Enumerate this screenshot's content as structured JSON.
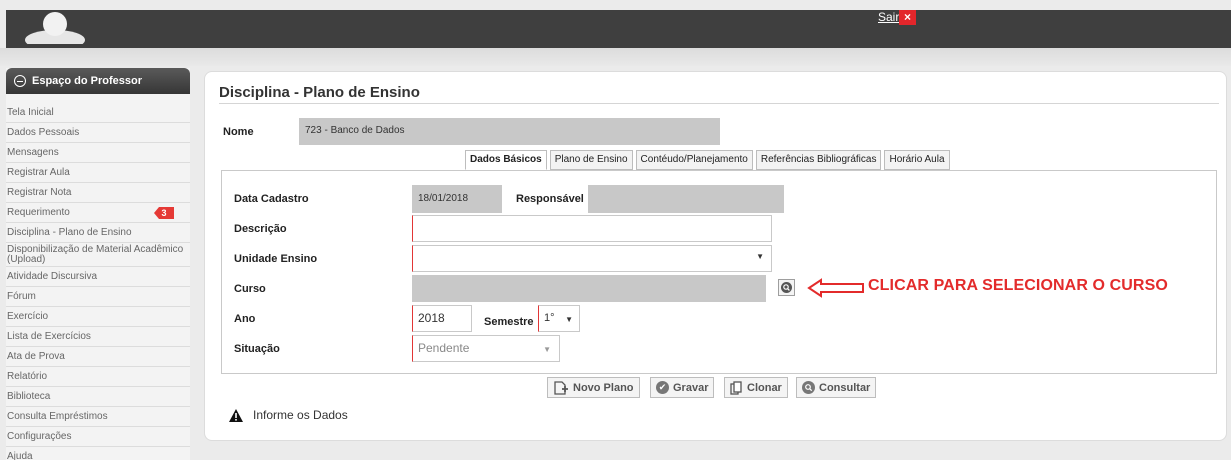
{
  "header": {
    "logout_label": "Sair",
    "close_symbol": "×",
    "accent_color": "#e3262b"
  },
  "sidebar": {
    "title": "Espaço do Professor",
    "items": [
      {
        "label": "Tela Inicial"
      },
      {
        "label": "Dados Pessoais"
      },
      {
        "label": "Mensagens"
      },
      {
        "label": "Registrar Aula"
      },
      {
        "label": "Registrar Nota"
      },
      {
        "label": "Requerimento",
        "badge": "3"
      },
      {
        "label": "Disciplina - Plano de Ensino"
      },
      {
        "label": "Disponibilização de Material Acadêmico (Upload)"
      },
      {
        "label": "Atividade Discursiva"
      },
      {
        "label": "Fórum"
      },
      {
        "label": "Exercício"
      },
      {
        "label": "Lista de Exercícios"
      },
      {
        "label": "Ata de Prova"
      },
      {
        "label": "Relatório"
      },
      {
        "label": "Biblioteca"
      },
      {
        "label": "Consulta Empréstimos"
      },
      {
        "label": "Configurações"
      },
      {
        "label": "Ajuda"
      }
    ]
  },
  "main": {
    "title": "Disciplina - Plano de Ensino",
    "nome_label": "Nome",
    "nome_value": "723 - Banco de Dados",
    "tabs": [
      {
        "label": "Dados Básicos",
        "active": true
      },
      {
        "label": "Plano de Ensino"
      },
      {
        "label": "Contéudo/Planejamento"
      },
      {
        "label": "Referências Bibliográficas"
      },
      {
        "label": "Horário Aula"
      }
    ],
    "form": {
      "data_cadastro_label": "Data Cadastro",
      "data_cadastro_value": "18/01/2018",
      "responsavel_label": "Responsável",
      "responsavel_value": "",
      "descricao_label": "Descrição",
      "descricao_value": "",
      "unidade_label": "Unidade Ensino",
      "unidade_value": "",
      "curso_label": "Curso",
      "curso_value": "",
      "ano_label": "Ano",
      "ano_value": "2018",
      "semestre_label": "Semestre",
      "semestre_value": "1°",
      "situacao_label": "Situação",
      "situacao_value": "Pendente"
    },
    "buttons": {
      "novo": "Novo Plano",
      "gravar": "Gravar",
      "clonar": "Clonar",
      "consultar": "Consultar"
    },
    "message": "Informe os Dados",
    "annotation": "CLICAR PARA SELECIONAR O CURSO",
    "annotation_color": "#e32b2b"
  }
}
